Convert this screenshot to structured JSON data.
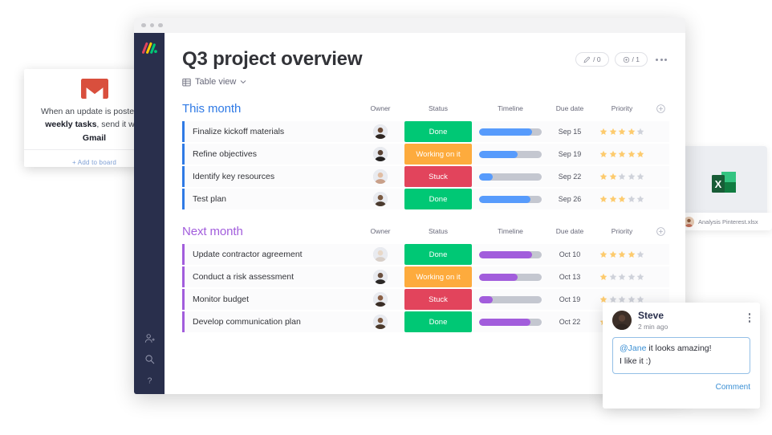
{
  "gmail_card": {
    "icon": "gmail-icon",
    "text_prefix": "When an update is posted in ",
    "bold_1": "weekly tasks",
    "text_mid": ", send it with ",
    "bold_2": "Gmail",
    "add_link": "+ Add to board"
  },
  "window": {
    "sidebar": {
      "logo": "monday-logo",
      "bottom_icons": [
        "invite-person-icon",
        "search-icon",
        "help-icon"
      ]
    },
    "header": {
      "title": "Q3 project overview",
      "view_icon": "table-view-icon",
      "view_label": "Table view",
      "view_chevron": "chevron-down-icon",
      "badges": [
        {
          "icon": "activity-log-icon",
          "text": "/ 0"
        },
        {
          "icon": "watch-eye-icon",
          "text": "/ 1"
        }
      ],
      "menu": "kebab-menu-icon"
    },
    "columns": [
      "Owner",
      "Status",
      "Timeline",
      "Due date",
      "Priority"
    ],
    "add_column_icon": "add-column-icon",
    "groups": [
      {
        "name": "This month",
        "color": "#2f7ae5",
        "bar_color": "#579bfc",
        "rows": [
          {
            "name": "Finalize kickoff materials",
            "avatar": "owner-avatar",
            "status": "Done",
            "status_class": "st-done",
            "progress": 85,
            "due": "Sep 15",
            "priority": 4
          },
          {
            "name": "Refine objectives",
            "avatar": "owner-avatar",
            "status": "Working on it",
            "status_class": "st-working",
            "progress": 62,
            "due": "Sep 19",
            "priority": 5
          },
          {
            "name": "Identify key resources",
            "avatar": "owner-avatar",
            "status": "Stuck",
            "status_class": "st-stuck",
            "progress": 22,
            "due": "Sep 22",
            "priority": 2
          },
          {
            "name": "Test plan",
            "avatar": "owner-avatar",
            "status": "Done",
            "status_class": "st-done",
            "progress": 82,
            "due": "Sep 26",
            "priority": 3
          }
        ]
      },
      {
        "name": "Next month",
        "color": "#a25ddc",
        "bar_color": "#a25ddc",
        "rows": [
          {
            "name": "Update contractor agreement",
            "avatar": "owner-avatar",
            "status": "Done",
            "status_class": "st-done",
            "progress": 85,
            "due": "Oct 10",
            "priority": 4
          },
          {
            "name": "Conduct a risk assessment",
            "avatar": "owner-avatar",
            "status": "Working on it",
            "status_class": "st-working",
            "progress": 62,
            "due": "Oct 13",
            "priority": 1
          },
          {
            "name": "Monitor budget",
            "avatar": "owner-avatar",
            "status": "Stuck",
            "status_class": "st-stuck",
            "progress": 22,
            "due": "Oct 19",
            "priority": 1
          },
          {
            "name": "Develop communication plan",
            "avatar": "owner-avatar",
            "status": "Done",
            "status_class": "st-done",
            "progress": 82,
            "due": "Oct 22",
            "priority": 1
          }
        ]
      }
    ]
  },
  "excel_card": {
    "icon": "excel-file-icon",
    "avatar": "uploader-avatar",
    "filename": "Analysis Pinterest.xlsx"
  },
  "comment_card": {
    "avatar": "commenter-avatar",
    "author": "Steve",
    "time": "2 min ago",
    "mention": "@Jane",
    "line1_rest": " it looks amazing!",
    "line2": "I like it :)",
    "submit": "Comment",
    "menu": "kebab-menu-icon"
  },
  "colors": {
    "accent_blue": "#579bfc",
    "accent_purple": "#a25ddc",
    "done_green": "#00c875",
    "working_orange": "#fdab3d",
    "stuck_red": "#e2445c",
    "sidebar_navy": "#292f4c",
    "link_blue": "#3a8fd4"
  }
}
